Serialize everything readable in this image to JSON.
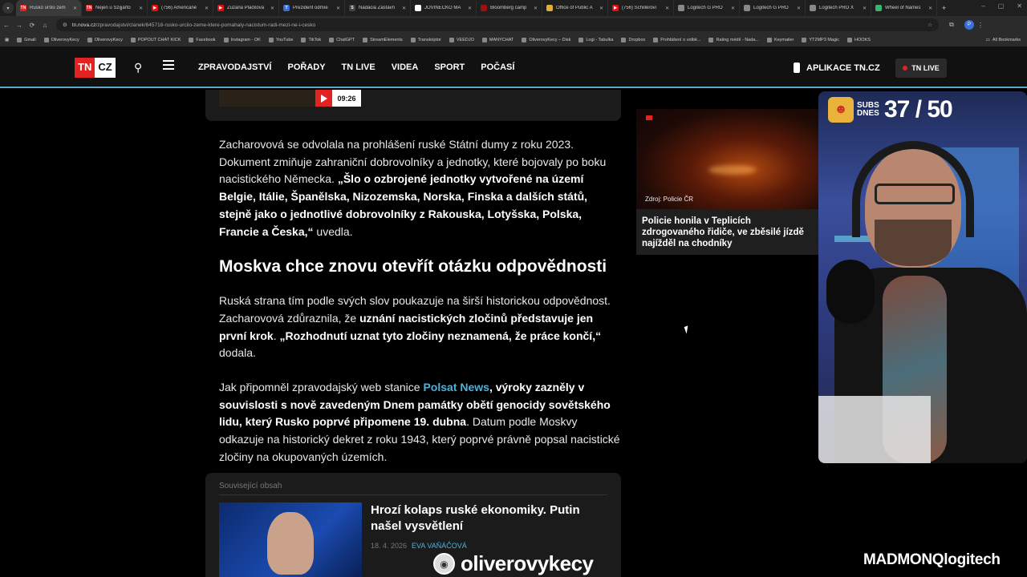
{
  "browser": {
    "tabs": [
      {
        "title": "Rusko uršlo zem",
        "color": "#e32222",
        "mark": "TN",
        "active": true
      },
      {
        "title": "Nejen u Szijjártó",
        "color": "#e32222",
        "mark": "TN"
      },
      {
        "title": "(756) Americané",
        "color": "#e31111",
        "mark": "▶"
      },
      {
        "title": "Zuzana Plačková",
        "color": "#e31111",
        "mark": "▶"
      },
      {
        "title": "Prezident odmíe",
        "color": "#3b6fd8",
        "mark": "T"
      },
      {
        "title": "Nadácia Zastavn",
        "color": "#444",
        "mark": "S"
      },
      {
        "title": "JOVINEČKO MA",
        "color": "#fff",
        "mark": ""
      },
      {
        "title": "Bloomberg camp",
        "color": "#a01010",
        "mark": ""
      },
      {
        "title": "Office of Public A",
        "color": "#e0b030",
        "mark": ""
      },
      {
        "title": "(756) Schillerovi",
        "color": "#e31111",
        "mark": "▶"
      },
      {
        "title": "Logitech G PRO",
        "color": "#888",
        "mark": ""
      },
      {
        "title": "Logitech G PRO",
        "color": "#888",
        "mark": ""
      },
      {
        "title": "Logitech PRO X",
        "color": "#888",
        "mark": ""
      },
      {
        "title": "Wheel of Names",
        "color": "#3bb36e",
        "mark": ""
      }
    ],
    "url_domain": "tn.nova.cz",
    "url_path": "/zpravodajstvi/clanek/645718-rusko-urcilo-zeme-ktere-pomahaly-nacistum-radi-mezi-ne-i-cesko",
    "profile_initial": "P",
    "bookmarks": [
      "Gmail",
      "OliverovyKecy",
      "OliverovyKecy",
      "POPOUT CHAT KICK",
      "Facebook",
      "Instagram - OK",
      "YouTube",
      "TikTok",
      "ChatGPT",
      "StreamElements",
      "Transkriptor",
      "VEEDJO",
      "MANYCHAT",
      "OliverovyKecy – Disk",
      "Logi - Tabulka",
      "Dropbox",
      "Prohlášení o volbě...",
      "Rating médií - Nada...",
      "Keymailer",
      "YT2MP3 Magic",
      "HOOKS"
    ],
    "all_bookmarks": "All Bookmarks"
  },
  "site": {
    "logo_tn": "TN",
    "logo_cz": "CZ",
    "nav": [
      "ZPRAVODAJSTVÍ",
      "POŘADY",
      "TN LIVE",
      "VIDEA",
      "SPORT",
      "POČASÍ"
    ],
    "app_link": "APLIKACE TN.CZ",
    "live_button": "TN LIVE"
  },
  "video": {
    "duration": "09:26"
  },
  "article": {
    "p1_a": "Zacharovová se odvolala na prohlášení ruské Státní dumy z roku 2023. Dokument zmiňuje zahraniční dobrovolníky a jednotky, které bojovaly po boku nacistického Německa. ",
    "p1_b": "„Šlo o ozbrojené jednotky vytvořené na území Belgie, Itálie, Španělska, Nizozemska, Norska, Finska a dalších států, stejně jako o jednotlivé dobrovolníky z Rakouska, Lotyšska, Polska, Francie a Česka,“",
    "p1_c": " uvedla.",
    "heading": "Moskva chce znovu otevřít otázku odpovědnosti",
    "p2_a": "Ruská strana tím podle svých slov poukazuje na širší historickou odpovědnost. Zacharovová zdůraznila, že ",
    "p2_b": "uznání nacistických zločinů představuje jen první krok",
    "p2_c": ". ",
    "p2_d": "„Rozhodnutí uznat tyto zločiny neznamená, že práce končí,“",
    "p2_e": " dodala.",
    "p3_a": "Jak připomněl zpravodajský web stanice ",
    "p3_link": "Polsat News",
    "p3_b": ", výroky zazněly v souvislosti s nově zavedeným Dnem památky obětí genocidy sovětského lidu, který Rusko poprvé připomene 19. dubna",
    "p3_c": ". Datum podle Moskvy odkazuje na historický dekret z roku 1943, který poprvé právně popsal nacistické zločiny na okupovaných územích."
  },
  "related": {
    "label": "Související obsah",
    "title": "Hrozí kolaps ruské ekonomiky. Putin našel vysvětlení",
    "date": "18. 4. 2026",
    "author": "EVA VAŇÁČOVÁ"
  },
  "sidebar_card": {
    "source": "Zdroj: Policie ČR",
    "title": "Policie honila v Teplicích zdrogovaného řidiče, ve zběsilé jízdě najížděl na chodníky"
  },
  "stream": {
    "subs_label": "SUBS DNES",
    "subs_count": "37 / 50",
    "channel": "oliverovykecy",
    "sponsor_a": "MADMONQ",
    "sponsor_b": "logitech"
  }
}
